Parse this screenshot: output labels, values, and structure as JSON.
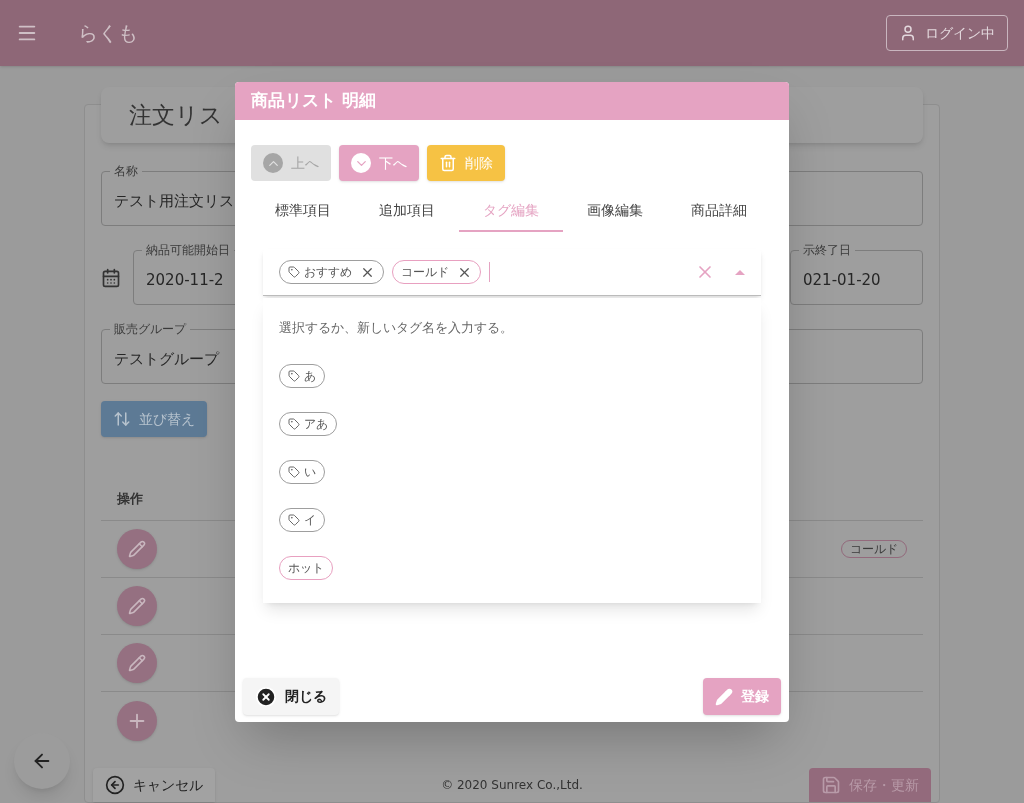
{
  "app_bar": {
    "title": "らくも",
    "login_button": "ログイン中"
  },
  "page": {
    "title": "注文リス",
    "name_field": {
      "label": "名称",
      "value": "テスト用注文リス"
    },
    "date_start": {
      "label": "納品可能開始日",
      "value": "2020-11-2"
    },
    "date_end": {
      "label": "示終了日",
      "value": "021-01-20"
    },
    "group_field": {
      "label": "販売グループ",
      "value": "テストグループ"
    },
    "sort_button": "並び替え",
    "table": {
      "column": "操作",
      "rows": [
        {
          "kind": "edit",
          "tags": [
            "コールド"
          ]
        },
        {
          "kind": "edit",
          "tags": []
        },
        {
          "kind": "edit",
          "tags": []
        },
        {
          "kind": "add",
          "tags": []
        }
      ]
    }
  },
  "cancel_button": "キャンセル",
  "footer": "© 2020 Sunrex Co.,Ltd.",
  "save_button": "保存・更新",
  "dialog": {
    "title": "商品リスト 明細",
    "actions": [
      {
        "label": "上へ",
        "kind": "up",
        "disabled": true
      },
      {
        "label": "下へ",
        "kind": "down",
        "disabled": false
      },
      {
        "label": "削除",
        "kind": "delete",
        "disabled": false
      }
    ],
    "tabs": [
      {
        "label": "標準項目",
        "selected": false
      },
      {
        "label": "追加項目",
        "selected": false
      },
      {
        "label": "タグ編集",
        "selected": true
      },
      {
        "label": "画像編集",
        "selected": false
      },
      {
        "label": "商品詳細",
        "selected": false
      }
    ],
    "chips": [
      {
        "label": "おすすめ",
        "kind": "tagged",
        "color": "#9e9e9e"
      },
      {
        "label": "コールド",
        "kind": "plain",
        "color": "#e8a0c0"
      }
    ],
    "hint": "選択するか、新しいタグ名を入力する。",
    "options": [
      {
        "label": "あ",
        "kind": "tagged",
        "color": "#9e9e9e"
      },
      {
        "label": "アあ",
        "kind": "tagged",
        "color": "#9e9e9e"
      },
      {
        "label": "い",
        "kind": "tagged",
        "color": "#9e9e9e"
      },
      {
        "label": "イ",
        "kind": "tagged",
        "color": "#9e9e9e"
      },
      {
        "label": "ホット",
        "kind": "plain",
        "color": "#e8a0c0"
      }
    ],
    "close_button": "閉じる",
    "submit_button": "登録"
  }
}
